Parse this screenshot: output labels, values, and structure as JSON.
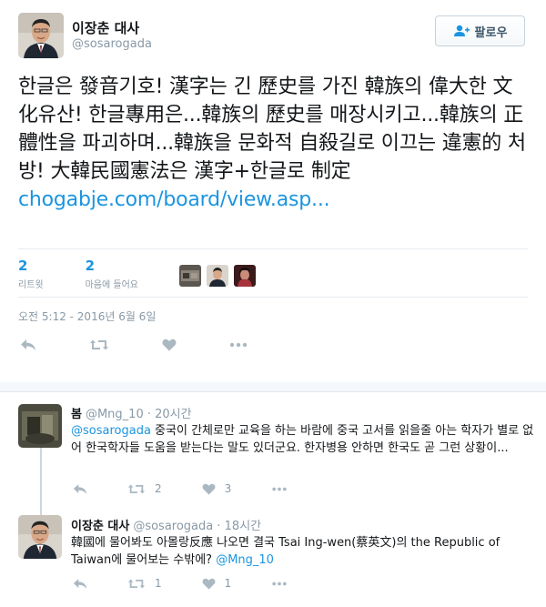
{
  "tweet": {
    "author_name": "이장춘 대사",
    "author_handle": "@sosarogada",
    "follow_label": "팔로우",
    "text": "한글은 發音기호! 漢字는 긴 歷史를 가진 韓族의 偉大한 文化유산! 한글專用은...韓族의 歷史를 매장시키고...韓族의 正體性을 파괴하며...韓族을 문화적 自殺길로 이끄는 違憲的 처방! 大韓民國憲法은 漢字+한글로 制定",
    "link": "chogabje.com/board/view.asp...",
    "retweets_count": "2",
    "retweets_label": "리트윗",
    "likes_count": "2",
    "likes_label": "마음에 들어요",
    "timestamp": "오전 5:12 - 2016년 6월 6일",
    "liker_avatars": [
      "liker-1",
      "liker-2",
      "liker-3"
    ]
  },
  "replies": [
    {
      "name": "봄",
      "handle": "@Mng_10",
      "time_sep": " · ",
      "time": "20시간",
      "mention": "@sosarogada",
      "text": " 중국이 간체로만 교육을 하는 바람에 중국 고서를 읽을줄 아는 학자가 별로 없어 한국학자들 도움을 받는다는 말도 있더군요. 한자병용 안하면 한국도 곧 그런 상황이...",
      "retweets": "2",
      "likes": "3"
    },
    {
      "name": "이장춘 대사",
      "handle": "@sosarogada",
      "time_sep": " · ",
      "time": "18시간",
      "text": "韓國에 물어봐도 아몰랑反應 나오면 결국 Tsai Ing-wen(蔡英文)의 the Republic of Taiwan에 물어보는 수밖에? ",
      "mention": "@Mng_10",
      "retweets": "1",
      "likes": "1"
    }
  ],
  "icons": [
    "reply-icon",
    "retweet-icon",
    "heart-icon",
    "more-icon",
    "follow-person-icon"
  ],
  "colors": {
    "link": "#1b95e0",
    "muted": "#8899a6",
    "icon": "#aab8c2",
    "text": "#14171a"
  }
}
